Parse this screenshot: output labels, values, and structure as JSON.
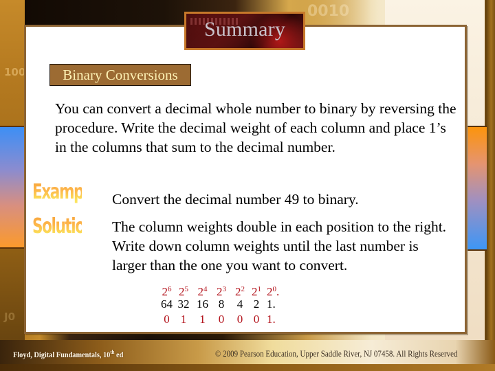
{
  "slide": {
    "title": "Summary",
    "subtitle": "Binary Conversions",
    "intro_text": "You can convert a decimal whole number to binary by reversing the procedure. Write the decimal weight of each column and place 1’s in the columns that sum to the decimal number.",
    "example_label": "Example",
    "solution_label": "Solution",
    "question_text": "Convert the decimal number 49 to binary.",
    "solution_text": "The column weights double in each position to the right. Write down column weights until the last number is larger than the one you want to convert.",
    "weights_table": {
      "powers": [
        {
          "base": "2",
          "exp": "6",
          "suffix": ""
        },
        {
          "base": "2",
          "exp": "5",
          "suffix": ""
        },
        {
          "base": "2",
          "exp": "4",
          "suffix": ""
        },
        {
          "base": "2",
          "exp": "3",
          "suffix": ""
        },
        {
          "base": "2",
          "exp": "2",
          "suffix": ""
        },
        {
          "base": "2",
          "exp": "1",
          "suffix": ""
        },
        {
          "base": "2",
          "exp": "0",
          "suffix": "."
        }
      ],
      "decimal_weights": [
        "64",
        "32",
        "16",
        "8",
        "4",
        "2",
        "1."
      ],
      "bits": [
        "0",
        "1",
        "1",
        "0",
        "0",
        "0",
        "1."
      ]
    }
  },
  "background": {
    "digits_left_top": "100",
    "digits_left_bottom": "J0",
    "digits_top": "0010"
  },
  "footer": {
    "book": "Floyd, Digital Fundamentals, 10",
    "book_ordinal": "th",
    "book_suffix": " ed",
    "copyright": "© 2009 Pearson Education, Upper Saddle River, NJ 07458. All Rights Reserved"
  },
  "colors": {
    "panel_border": "#8c6434",
    "subtitle_bg": "#9c6b33",
    "subtitle_text": "#fdf1b4",
    "title_text": "#c9c4cc",
    "accent_red": "#b3121b",
    "label_orange": "#fb9d2a"
  }
}
